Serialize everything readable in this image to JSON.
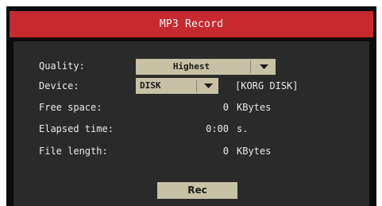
{
  "window": {
    "title": "MP3 Record"
  },
  "fields": {
    "quality": {
      "label": "Quality:",
      "value": "Highest"
    },
    "device": {
      "label": "Device:",
      "value": "DISK",
      "name": "[KORG DISK]"
    },
    "free_space": {
      "label": "Free space:",
      "value": "0",
      "unit": "KBytes"
    },
    "elapsed_time": {
      "label": "Elapsed time:",
      "value": "0:00",
      "unit": "s."
    },
    "file_length": {
      "label": "File length:",
      "value": "0",
      "unit": "KBytes"
    }
  },
  "buttons": {
    "rec_label": "Rec"
  },
  "icons": {
    "dropdown_arrow": "chevron-down-icon"
  },
  "colors": {
    "title_bar": "#c62a2f",
    "background": "#0b0b0b",
    "panel": "#2a2a2a",
    "control": "#c7c1a6",
    "text": "#e8e8e8"
  }
}
